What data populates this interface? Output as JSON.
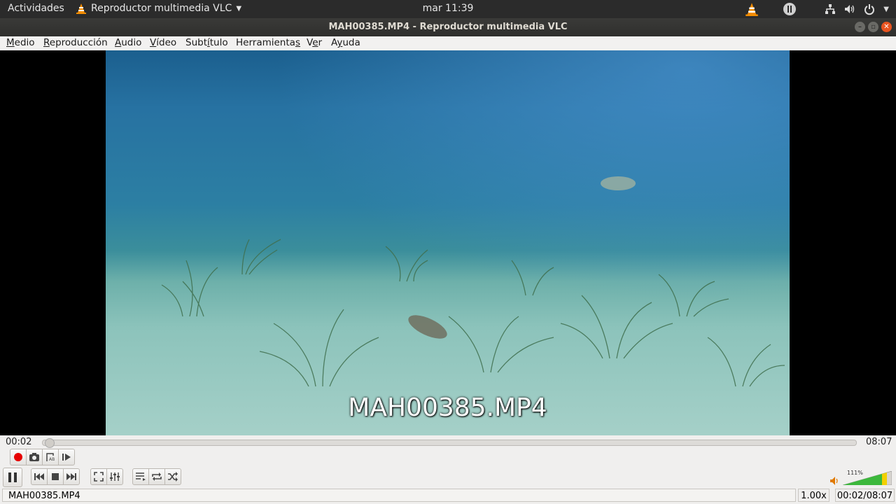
{
  "topbar": {
    "activities": "Actividades",
    "app_menu": "Reproductor multimedia VLC",
    "clock": "mar 11:39"
  },
  "titlebar": {
    "title": "MAH00385.MP4 - Reproductor multimedia VLC"
  },
  "menu": [
    {
      "key": "M",
      "rest": "edio"
    },
    {
      "pre": "",
      "key": "R",
      "rest": "eproducción"
    },
    {
      "key": "A",
      "rest": "udio"
    },
    {
      "key": "V",
      "rest": "ídeo"
    },
    {
      "pre": "Subt",
      "key": "í",
      "rest": "tulo"
    },
    {
      "pre": "Herramienta",
      "key": "s",
      "rest": ""
    },
    {
      "pre": "V",
      "key": "e",
      "rest": "r"
    },
    {
      "pre": "A",
      "key": "y",
      "rest": "uda"
    }
  ],
  "video": {
    "overlay_title": "MAH00385.MP4"
  },
  "playback": {
    "elapsed": "00:02",
    "total": "08:07",
    "progress": 0.004,
    "volume_label": "111%",
    "volume_level": 1.11
  },
  "status": {
    "filename": "MAH00385.MP4",
    "rate": "1.00x",
    "time_position": "00:02/08:07"
  },
  "icons": {
    "record": "record-icon",
    "snapshot": "camera-icon",
    "loop_ab": "loop-ab-icon",
    "frame_step": "frame-step-icon",
    "pause": "pause-icon",
    "previous": "previous-icon",
    "stop": "stop-icon",
    "next": "next-icon",
    "fullscreen": "fullscreen-icon",
    "extended": "equalizer-icon",
    "playlist": "playlist-icon",
    "loop": "loop-icon",
    "shuffle": "shuffle-icon",
    "volume": "speaker-icon"
  },
  "colors": {
    "accent": "#e95420",
    "record": "#e60000",
    "vlc_orange": "#f28c00",
    "volume_green": "#3cb83c"
  }
}
